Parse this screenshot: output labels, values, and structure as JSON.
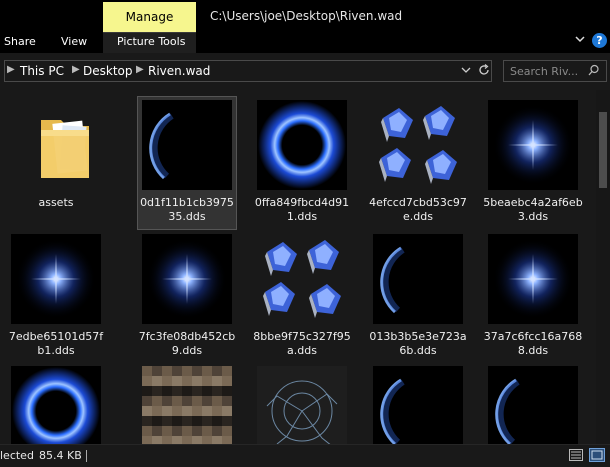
{
  "window": {
    "title": "C:\\Users\\joe\\Desktop\\Riven.wad"
  },
  "ribbon": {
    "tabs": {
      "share": "Share",
      "view": "View",
      "picture_tools": "Picture Tools",
      "manage": "Manage"
    },
    "expand_icon": "chevron-down-icon",
    "help_label": "?"
  },
  "address": {
    "crumbs": [
      "This PC",
      "Desktop",
      "Riven.wad"
    ],
    "search_placeholder": "Search Riv..."
  },
  "files": [
    {
      "name": "assets",
      "kind": "folder"
    },
    {
      "name": "0d1f11b1cb397535.dds",
      "kind": "arc",
      "selected": true
    },
    {
      "name": "0ffa849fbcd4d911.dds",
      "kind": "ring"
    },
    {
      "name": "4efccd7cbd53c97e.dds",
      "kind": "crystals"
    },
    {
      "name": "5beaebc4a2af6eb3.dds",
      "kind": "star"
    },
    {
      "name": "7edbe65101d57fb1.dds",
      "kind": "star"
    },
    {
      "name": "7fc3fe08db452cb9.dds",
      "kind": "star"
    },
    {
      "name": "8bbe9f75c327f95a.dds",
      "kind": "crystals"
    },
    {
      "name": "013b3b5e3e723a6b.dds",
      "kind": "arc"
    },
    {
      "name": "37a7c6fcc16a7688.dds",
      "kind": "star"
    },
    {
      "name": "",
      "kind": "ring"
    },
    {
      "name": "",
      "kind": "texture"
    },
    {
      "name": "",
      "kind": "cracks"
    },
    {
      "name": "",
      "kind": "arc"
    },
    {
      "name": "",
      "kind": "arc"
    }
  ],
  "status": {
    "selected_text": "lected",
    "size": "85.4 KB"
  }
}
